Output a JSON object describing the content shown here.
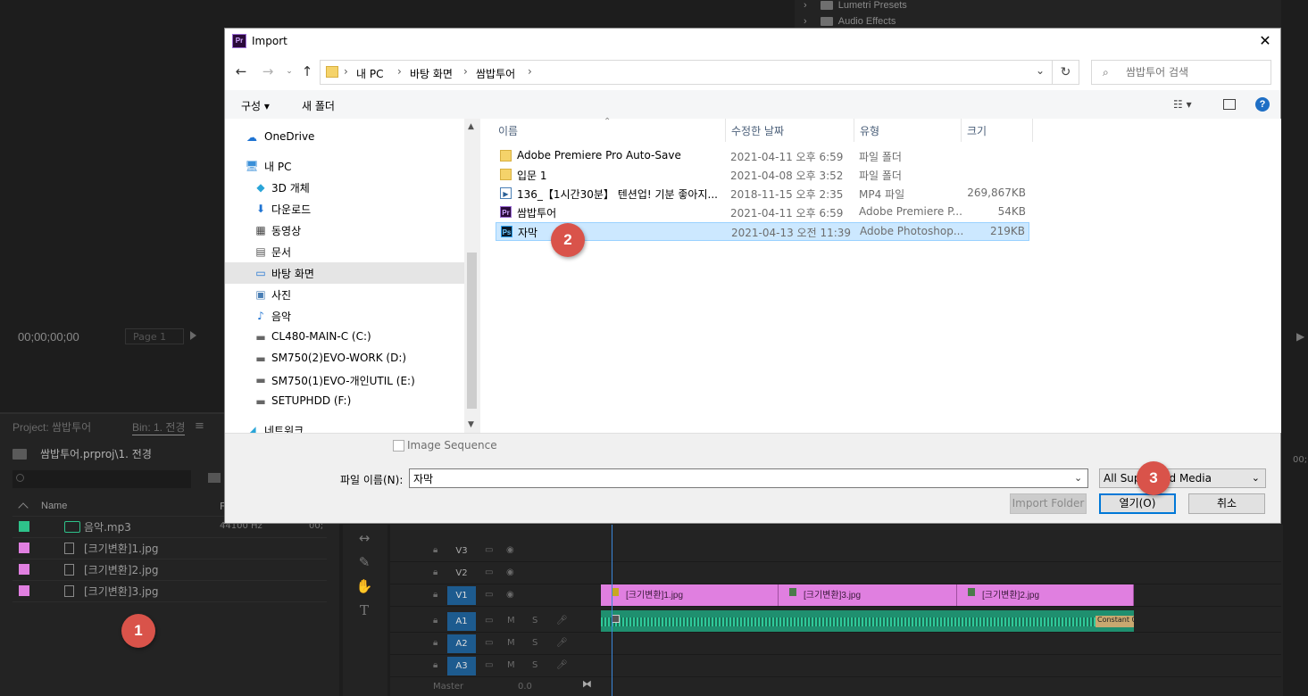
{
  "bg": {
    "effects_items": [
      "Lumetri Presets",
      "Audio Effects"
    ],
    "timecode": "00;00;00;00",
    "page_label": "Page 1",
    "project_tab": "Project: 쌈밥투어",
    "bin_tab": "Bin: 1. 전경",
    "bin_menu": "≡",
    "project_path": "쌈밥투어.prproj\\1. 전경",
    "name_header": "Name",
    "col_extra": "F",
    "project_items": [
      {
        "name": "음악.mp3",
        "color": "#2ec28a",
        "rate": "44100 Hz",
        "extra": "00;"
      },
      {
        "name": "[크기변환]1.jpg",
        "color": "#e07fe0"
      },
      {
        "name": "[크기변환]2.jpg",
        "color": "#e07fe0"
      },
      {
        "name": "[크기변환]3.jpg",
        "color": "#e07fe0"
      }
    ],
    "tracks": {
      "v3": "V3",
      "v2": "V2",
      "v1": "V1",
      "a1": "A1",
      "a2": "A2",
      "a3": "A3"
    },
    "track_m": "M",
    "track_s": "S",
    "clips": [
      "[크기변환]1.jpg",
      "[크기변환]3.jpg",
      "[크기변환]2.jpg"
    ],
    "constant_label": "Constant C",
    "master_label": "Master",
    "master_value": "0.0",
    "timecode_right": "00;"
  },
  "dialog": {
    "title": "Import",
    "logo": "Pr",
    "close": "✕",
    "breadcrumbs": [
      "내 PC",
      "바탕 화면",
      "쌈밥투어"
    ],
    "search_placeholder": "쌈밥투어 검색",
    "cmd_organize": "구성 ▾",
    "cmd_new_folder": "새 폴더",
    "help": "?",
    "nav": [
      {
        "label": "OneDrive",
        "icon": "cloud-icon"
      },
      {
        "label": "내 PC",
        "icon": "computer-icon"
      },
      {
        "label": "3D 개체",
        "icon": "cube-icon"
      },
      {
        "label": "다운로드",
        "icon": "download-icon"
      },
      {
        "label": "동영상",
        "icon": "film-icon"
      },
      {
        "label": "문서",
        "icon": "document-icon"
      },
      {
        "label": "바탕 화면",
        "icon": "desktop-icon"
      },
      {
        "label": "사진",
        "icon": "picture-icon"
      },
      {
        "label": "음악",
        "icon": "music-icon"
      },
      {
        "label": "CL480-MAIN-C (C:)",
        "icon": "drive-icon"
      },
      {
        "label": "SM750(2)EVO-WORK (D:)",
        "icon": "drive-icon"
      },
      {
        "label": "SM750(1)EVO-개인UTIL (E:)",
        "icon": "drive-icon"
      },
      {
        "label": "SETUPHDD (F:)",
        "icon": "drive-icon"
      },
      {
        "label": "네트워크",
        "icon": "network-icon"
      }
    ],
    "columns": {
      "name": "이름",
      "date": "수정한 날짜",
      "type": "유형",
      "size": "크기"
    },
    "files": [
      {
        "name": "Adobe Premiere Pro Auto-Save",
        "date": "2021-04-11 오후 6:59",
        "type": "파일 폴더",
        "size": "",
        "kind": "folder"
      },
      {
        "name": "입문 1",
        "date": "2021-04-08 오후 3:52",
        "type": "파일 폴더",
        "size": "",
        "kind": "folder"
      },
      {
        "name": "136_【1시간30분】 텐션업! 기분 좋아지...",
        "date": "2018-11-15 오후 2:35",
        "type": "MP4 파일",
        "size": "269,867KB",
        "kind": "mp4"
      },
      {
        "name": "쌈밥투어",
        "date": "2021-04-11 오후 6:59",
        "type": "Adobe Premiere P...",
        "size": "54KB",
        "kind": "pr"
      },
      {
        "name": "자막",
        "date": "2021-04-13 오전 11:39",
        "type": "Adobe Photoshop...",
        "size": "219KB",
        "kind": "ps"
      }
    ],
    "image_sequence": "Image Sequence",
    "filename_label": "파일 이름(N):",
    "filename_value": "자막",
    "type_value": "All Supported Media",
    "import_folder": "Import Folder",
    "open": "열기(O)",
    "cancel": "취소"
  },
  "badges": [
    "1",
    "2",
    "3"
  ]
}
